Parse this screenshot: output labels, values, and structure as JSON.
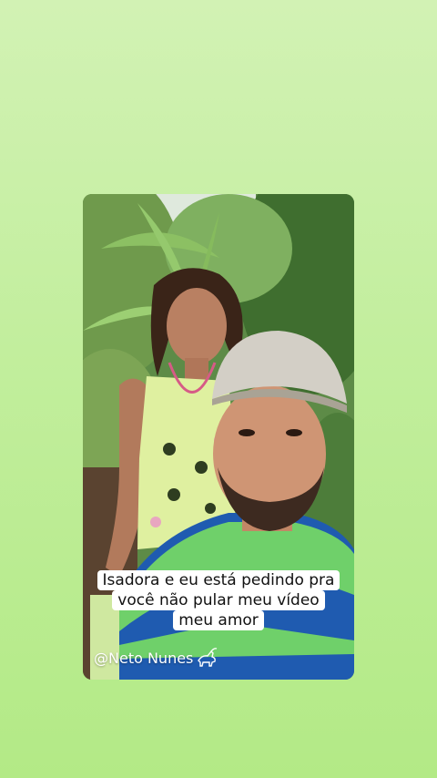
{
  "background": {
    "gradient_top": "#d2f2b4",
    "gradient_bottom": "#b3ea86"
  },
  "video": {
    "caption_lines": [
      "Isadora e eu está pedindo pra",
      "você não pular meu vídeo",
      "meu amor"
    ],
    "watermark": "@Neto Nunes",
    "watermark_icon": "goat-logo-icon"
  }
}
